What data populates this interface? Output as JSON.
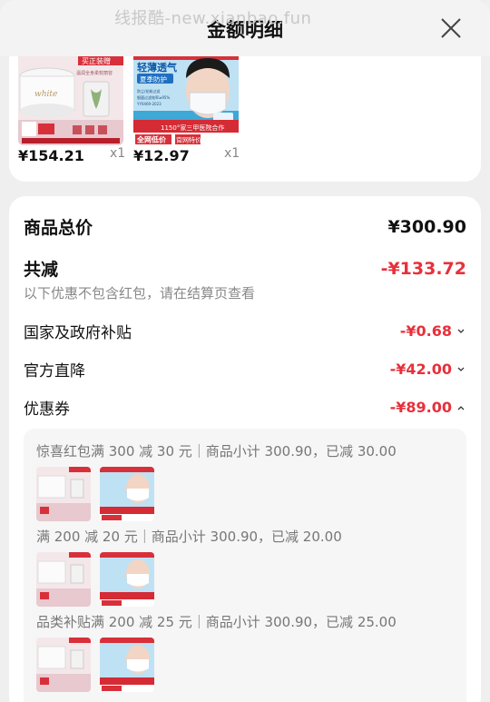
{
  "watermark": "线报酷-new.xianbao.fun",
  "header": {
    "title": "金额明细"
  },
  "products": [
    {
      "price": "¥154.21",
      "qty": "x1",
      "badge": "买正装赠",
      "caption": "温润全身柔软丽容",
      "icon": "cream-jar-product-image"
    },
    {
      "price": "¥12.97",
      "qty": "x1",
      "badge": "轻薄透气",
      "subtitle": "夏季防护",
      "tags": [
        "防尘/花粉过滤",
        "细菌过滤效率≥95%",
        "YY0469-2023"
      ],
      "ribbon": "1150°家三甲医院合作",
      "corner": "全网低价",
      "stamp": "官网特价",
      "icon": "face-mask-product-image"
    }
  ],
  "summary": {
    "total_label": "商品总价",
    "total_value": "¥300.90",
    "reduce_label": "共减",
    "reduce_value": "-¥133.72",
    "note": "以下优惠不包含红包，请在结算页查看",
    "items": [
      {
        "label": "国家及政府补贴",
        "value": "-¥0.68",
        "chevron": "chevron-down-icon"
      },
      {
        "label": "官方直降",
        "value": "-¥42.00",
        "chevron": "chevron-down-icon"
      },
      {
        "label": "优惠券",
        "value": "-¥89.00",
        "chevron": "chevron-up-icon"
      }
    ]
  },
  "coupons": [
    {
      "title": "惊喜红包满 300 减 30 元｜商品小计 300.90，已减 30.00"
    },
    {
      "title": "满 200 减 20 元｜商品小计 300.90，已减 20.00"
    },
    {
      "title": "品类补贴满 200 减 25 元｜商品小计 300.90，已减 25.00"
    }
  ],
  "colors": {
    "accent_red": "#e8303a",
    "card_bg": "#ffffff",
    "page_bg": "#efefef"
  }
}
